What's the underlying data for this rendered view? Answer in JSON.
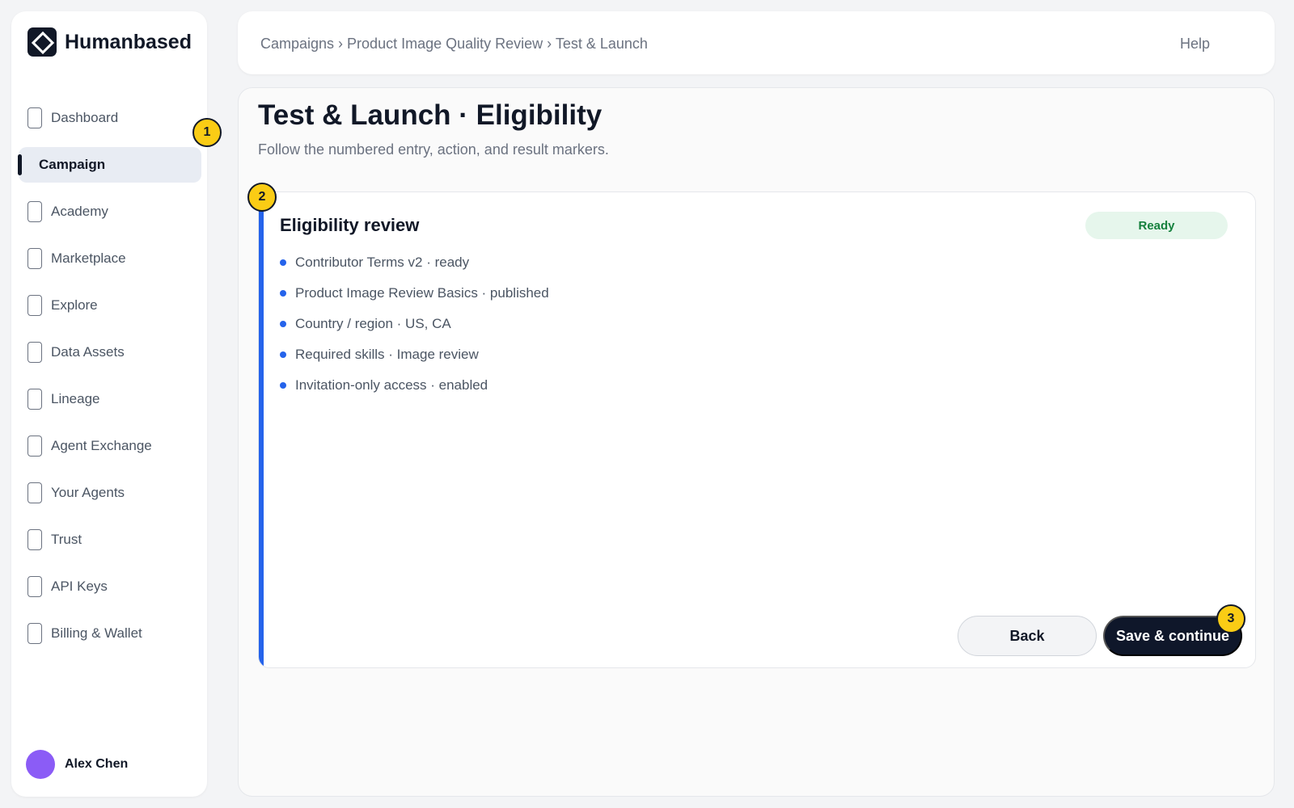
{
  "brand": {
    "name": "Humanbased",
    "logo_icon": "diamond-logo-icon"
  },
  "sidebar": {
    "items": [
      {
        "label": "Dashboard",
        "icon": "page-icon",
        "active": false
      },
      {
        "label": "Campaign",
        "icon": "",
        "active": true
      },
      {
        "label": "Academy",
        "icon": "page-icon",
        "active": false
      },
      {
        "label": "Marketplace",
        "icon": "page-icon",
        "active": false
      },
      {
        "label": "Explore",
        "icon": "page-icon",
        "active": false
      },
      {
        "label": "Data Assets",
        "icon": "page-icon",
        "active": false
      },
      {
        "label": "Lineage",
        "icon": "page-icon",
        "active": false
      },
      {
        "label": "Agent Exchange",
        "icon": "page-icon",
        "active": false
      },
      {
        "label": "Your Agents",
        "icon": "page-icon",
        "active": false
      },
      {
        "label": "Trust",
        "icon": "page-icon",
        "active": false
      },
      {
        "label": "API Keys",
        "icon": "page-icon",
        "active": false
      },
      {
        "label": "Billing & Wallet",
        "icon": "page-icon",
        "active": false
      }
    ],
    "user": {
      "name": "Alex Chen",
      "avatar_color": "#8b5cf6"
    }
  },
  "header": {
    "breadcrumb": "Campaigns › Product Image Quality Review › Test & Launch",
    "help_label": "Help"
  },
  "page": {
    "title": "Test & Launch · Eligibility",
    "subtitle": "Follow the numbered entry, action, and result markers."
  },
  "card": {
    "title": "Eligibility review",
    "status": "Ready",
    "requirements": [
      "Contributor Terms v2 · ready",
      "Product Image Review Basics · published",
      "Country / region · US, CA",
      "Required skills · Image review",
      "Invitation-only access · enabled"
    ],
    "back_label": "Back",
    "save_label": "Save & continue"
  },
  "markers": [
    "1",
    "2",
    "3"
  ],
  "colors": {
    "accent": "#2563eb",
    "marker": "#facc15",
    "primary_button": "#0f172a",
    "status_ready_bg": "#e6f6ec",
    "status_ready_text": "#15803d"
  }
}
